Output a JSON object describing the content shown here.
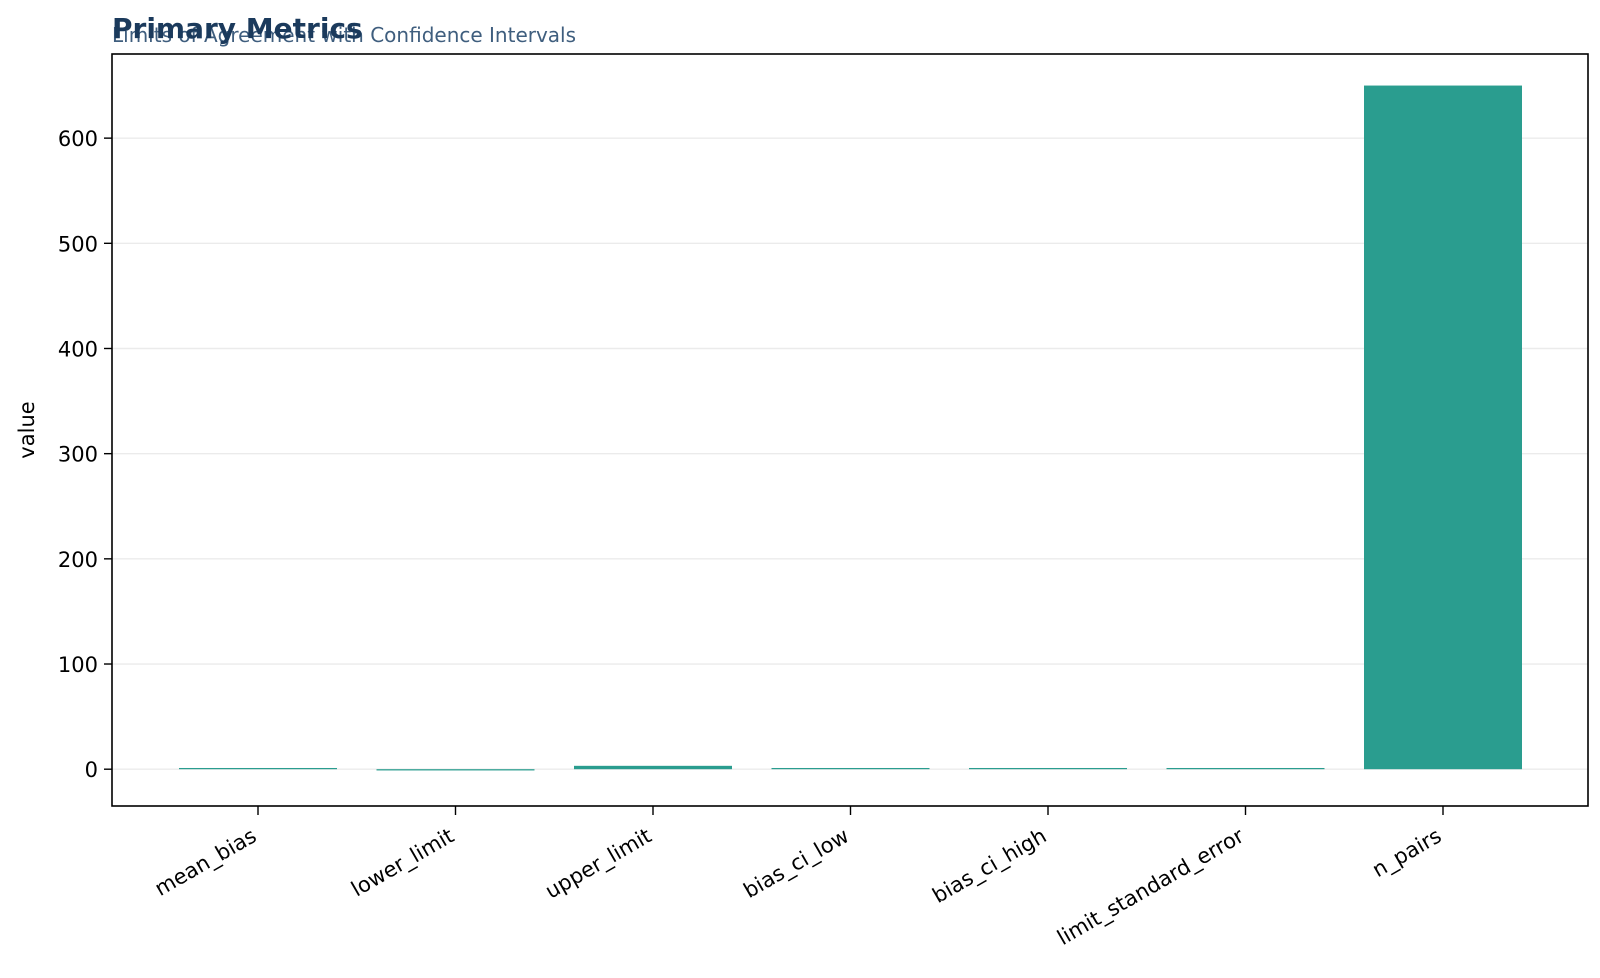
{
  "colors": {
    "title": "#1b3a5c",
    "subtitle": "#3f5e7e",
    "bar": "#2a9d8f",
    "grid": "#ebebeb",
    "axis": "#000000"
  },
  "chart_data": {
    "type": "bar",
    "title": "Primary Metrics",
    "subtitle": "Limits of Agreement with Confidence Intervals",
    "xlabel": "",
    "ylabel": "value",
    "categories": [
      "mean_bias",
      "lower_limit",
      "upper_limit",
      "bias_ci_low",
      "bias_ci_high",
      "limit_standard_error",
      "n_pairs"
    ],
    "values": [
      0.8,
      -1.2,
      3.2,
      0.6,
      1.0,
      0.5,
      650
    ],
    "ylim": [
      -35,
      680
    ],
    "yticks": [
      0,
      100,
      200,
      300,
      400,
      500,
      600
    ],
    "grid": "y",
    "legend": "none"
  }
}
